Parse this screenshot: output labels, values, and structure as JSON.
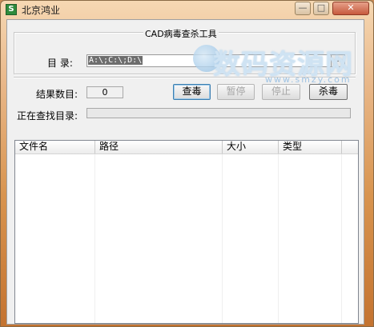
{
  "window": {
    "title": "北京鸿业",
    "icon": "app-logo-icon"
  },
  "caption_buttons": {
    "minimize": "—",
    "maximize": "□",
    "close": "✕"
  },
  "group": {
    "title": "CAD病毒查杀工具"
  },
  "directory": {
    "label": "目  录:",
    "value": "A:\\;C:\\;D:\\",
    "browse": "..."
  },
  "results": {
    "label": "结果数目:",
    "count": "0"
  },
  "buttons": {
    "scan": "查毒",
    "pause": "暂停",
    "stop": "停止",
    "kill": "杀毒"
  },
  "searching": {
    "label": "正在查找目录:"
  },
  "table": {
    "columns": [
      "文件名",
      "路径",
      "大小",
      "类型"
    ],
    "rows": []
  },
  "watermark": {
    "text": "数码资源网",
    "url": "www.smzy.com"
  }
}
